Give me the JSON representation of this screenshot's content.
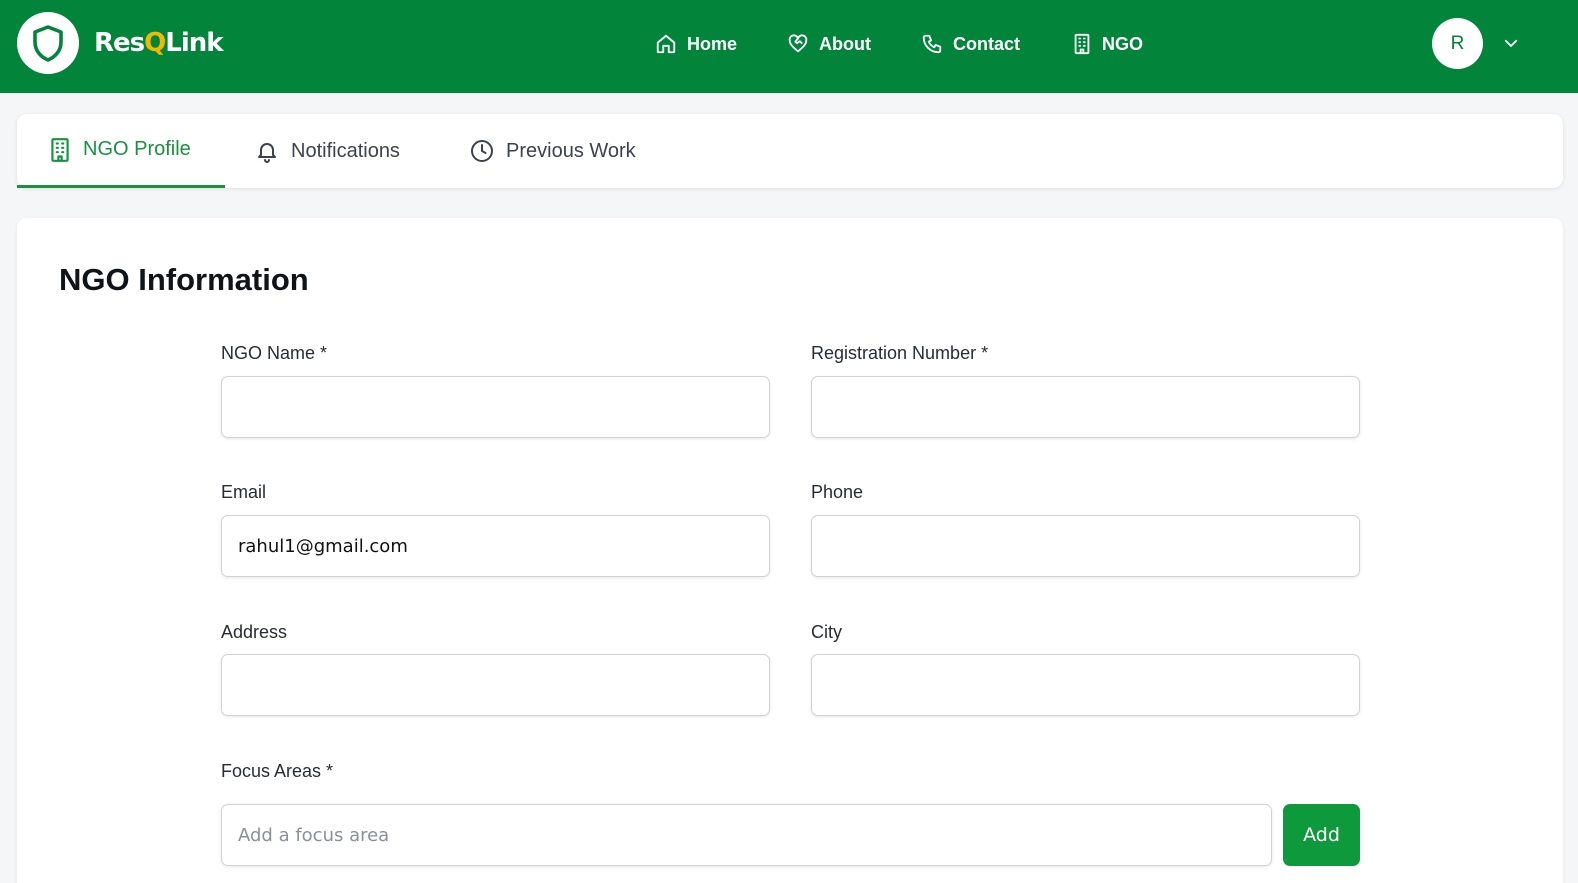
{
  "brand": {
    "part1": "Res",
    "part2": "Q",
    "part3": "Link"
  },
  "nav": {
    "home": "Home",
    "about": "About",
    "contact": "Contact",
    "ngo": "NGO"
  },
  "user": {
    "initial": "R"
  },
  "tabs": [
    {
      "label": "NGO Profile",
      "active": true
    },
    {
      "label": "Notifications",
      "active": false
    },
    {
      "label": "Previous Work",
      "active": false
    }
  ],
  "form": {
    "title": "NGO Information",
    "ngo_name": {
      "label": "NGO Name *",
      "value": ""
    },
    "registration_number": {
      "label": "Registration Number *",
      "value": ""
    },
    "email": {
      "label": "Email",
      "value": "rahul1@gmail.com"
    },
    "phone": {
      "label": "Phone",
      "value": ""
    },
    "address": {
      "label": "Address",
      "value": ""
    },
    "city": {
      "label": "City",
      "value": ""
    },
    "focus_areas": {
      "label": "Focus Areas *",
      "placeholder": "Add a focus area",
      "value": ""
    },
    "add_label": "Add"
  },
  "colors": {
    "primary": "#02843a",
    "accent": "#17923f",
    "logo_q": "#f5b800"
  }
}
